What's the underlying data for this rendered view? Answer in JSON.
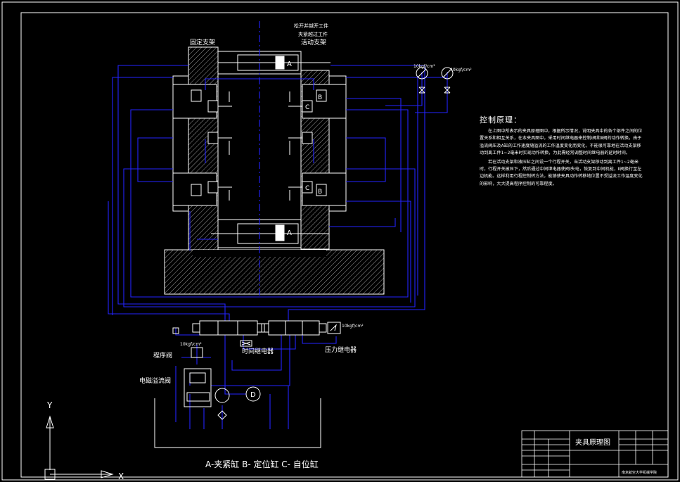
{
  "labels": {
    "fixed_support": "固定支架",
    "movable_support": "活动支架",
    "upper_label_1": "松开并越开工件",
    "upper_label_2": "夹紧越过工件",
    "gauge_left": "10kgf/cm²",
    "gauge_right": "40kgf/cm²",
    "cyl_top": "A",
    "cyl_bottom": "A",
    "cyl_b_top": "B",
    "cyl_c_top": "C",
    "cyl_b_bottom": "B",
    "cyl_c_bottom": "C",
    "time_relay": "时间继电器",
    "pressure_relay": "压力继电器",
    "pressure_valve_setting": "10kgf/cm²",
    "relief_setting": "10kgf/cm²",
    "sequence_valve": "程序阀",
    "solenoid_relief": "电磁溢流阀",
    "motor_symbol": "D",
    "legend": "A-夹紧缸    B- 定位缸    C- 自位缸",
    "axis_y": "Y",
    "axis_x": "X"
  },
  "notes": {
    "title": "控制原理：",
    "para1": "在上图中所表示的夹具原理图中，根据所示情况，说明夹具中的各个部件之间的位置关系和相互关系，在本夹具图中，采用时间继电器来控制Ⅰ阀和Ⅱ阀的动作转换，由于溢流阀压及A缸的工作速度随溢流的工作温度变化而变化，不能很可靠地在活动支架移动到离工件1~2毫米时实现动作转换，为此需经常调整时间继电器的延时时间。",
    "para2": "若在活动支架和液压缸之间设一个行程开关，当活动支架移动到离工件1~2毫米时，行程开关被压下，然后通过中间继电器使阀Ⅰ失电，恢复到中间机能，Ⅱ阀换行至左边机能。这样利用行程控制转方法，能够使夹具动作转移地位置不受溢流工作温度变化的影响，大大提高程序控制的可靠程度。"
  },
  "title_block": {
    "drawing_title": "夹具原理图",
    "org": "南京航空大学机械学院"
  },
  "colors": {
    "background": "#000000",
    "line_white": "#ffffff",
    "line_blue": "#2323ff"
  }
}
